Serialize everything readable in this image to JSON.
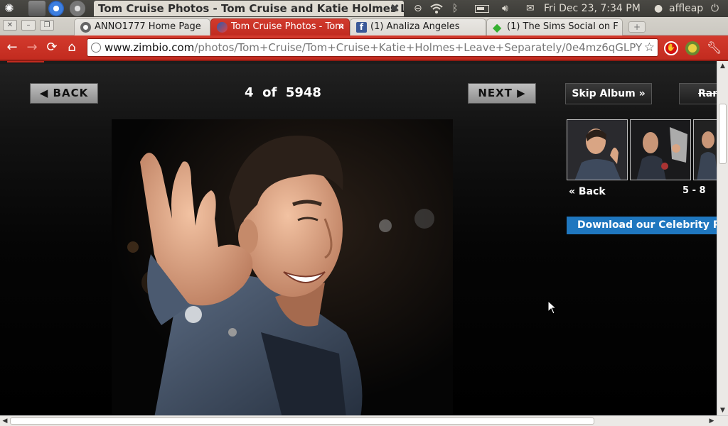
{
  "panel": {
    "ubuntu_icon": "ubuntu-logo-icon",
    "window_title": "Tom Cruise Photos - Tom Cruise and Katie Holmes L...",
    "datetime": "Fri Dec 23,  7:34 PM",
    "user": "affleap"
  },
  "tabs": [
    {
      "label": "ANNO1777 Home Page"
    },
    {
      "label": "Tom Cruise Photos - Tom"
    },
    {
      "label": "(1) Analiza Angeles"
    },
    {
      "label": "(1) The Sims Social on F"
    }
  ],
  "facebook_glyph": "f",
  "omnibox": {
    "host": "www.zimbio.com",
    "path": "/photos/Tom+Cruise/Tom+Cruise+Katie+Holmes+Leave+Separately/0e4mz6qGLPY"
  },
  "gallery": {
    "back_label": "◀ BACK",
    "next_label": "NEXT ▶",
    "current": "4",
    "of_label": "of",
    "total": "5948",
    "skip_label": "Skip Album »",
    "random_label": "Ran",
    "thumb_back_label": "« Back",
    "thumb_range": "5 - 8",
    "download_label": "Download our Celebrity Pictu"
  },
  "colors": {
    "chrome_accent": "#c22b1f",
    "download_blue": "#1f77bf"
  }
}
